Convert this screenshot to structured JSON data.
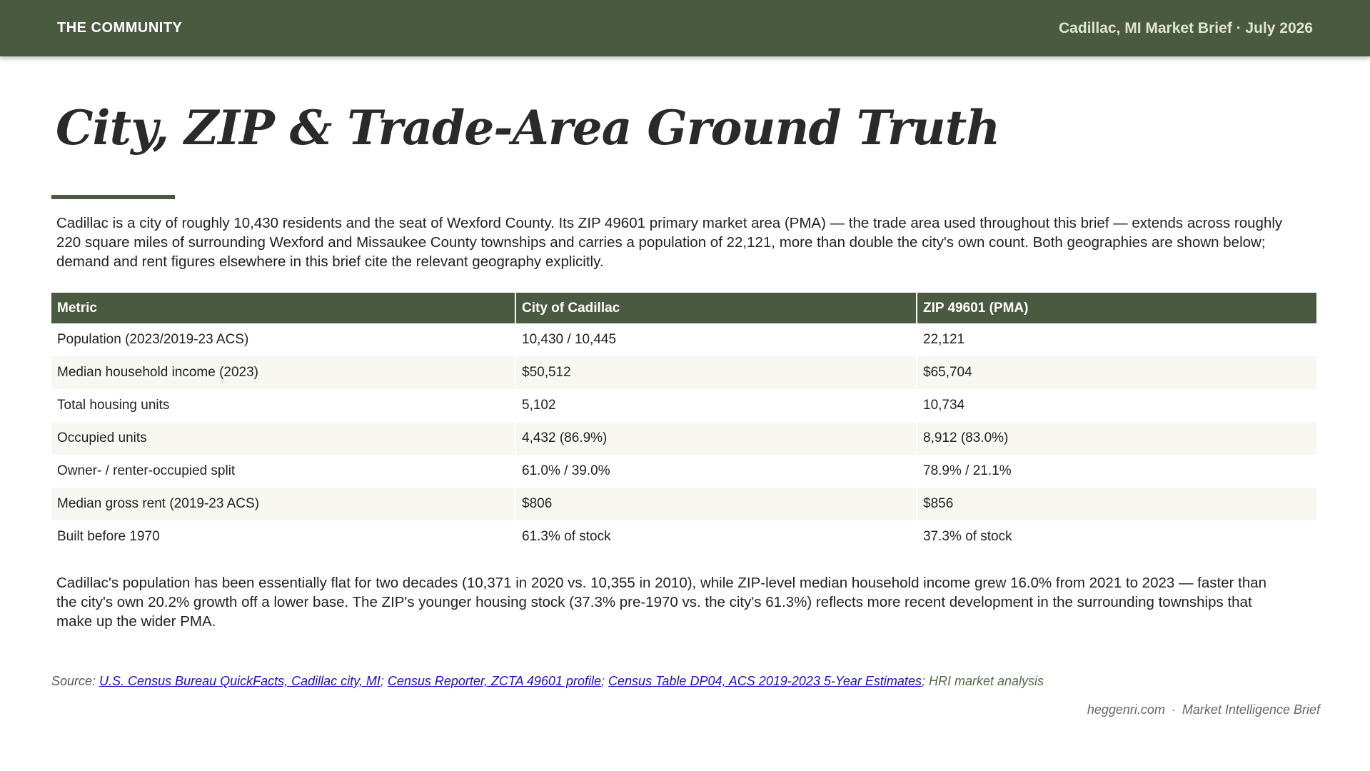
{
  "header": {
    "section": "THE COMMUNITY",
    "brief": "Cadillac, MI Market Brief · July 2026"
  },
  "title": "City, ZIP & Trade-Area Ground Truth",
  "intro": "Cadillac is a city of roughly 10,430 residents and the seat of Wexford County. Its ZIP 49601 primary market area (PMA) — the trade area used throughout this brief — extends across roughly 220 square miles of surrounding Wexford and Missaukee County townships and carries a population of 22,121, more than double the city's own count. Both geographies are shown below; demand and rent figures elsewhere in this brief cite the relevant geography explicitly.",
  "table": {
    "columns": [
      "Metric",
      "City of Cadillac",
      "ZIP 49601 (PMA)"
    ],
    "rows": [
      [
        "Population (2023/2019-23 ACS)",
        "10,430 / 10,445",
        "22,121"
      ],
      [
        "Median household income (2023)",
        "$50,512",
        "$65,704"
      ],
      [
        "Total housing units",
        "5,102",
        "10,734"
      ],
      [
        "Occupied units",
        "4,432 (86.9%)",
        "8,912 (83.0%)"
      ],
      [
        "Owner- / renter-occupied split",
        "61.0% / 39.0%",
        "78.9% / 21.1%"
      ],
      [
        "Median gross rent (2019-23 ACS)",
        "$806",
        "$856"
      ],
      [
        "Built before 1970",
        "61.3% of stock",
        "37.3% of stock"
      ]
    ]
  },
  "analysis": "Cadillac's population has been essentially flat for two decades (10,371 in 2020 vs. 10,355 in 2010), while ZIP-level median household income grew 16.0% from 2021 to 2023 — faster than the city's own 20.2% growth off a lower base. The ZIP's younger housing stock (37.3% pre-1970 vs. the city's 61.3%) reflects more recent development in the surrounding townships that make up the wider PMA.",
  "source": {
    "prefix": "Source: ",
    "links": [
      "U.S. Census Bureau QuickFacts, Cadillac city, MI",
      "Census Reporter, ZCTA 49601 profile",
      "Census Table DP04, ACS 2019-2023 5-Year Estimates"
    ],
    "separator": "; ",
    "suffix": "HRI market analysis"
  },
  "footer": {
    "site": "heggenri.com",
    "separator": "·",
    "label": "Market Intelligence Brief"
  },
  "colors": {
    "brand": "#4a5a40",
    "row_alt": "#f8f7f2",
    "link": "#1a0dcc"
  }
}
